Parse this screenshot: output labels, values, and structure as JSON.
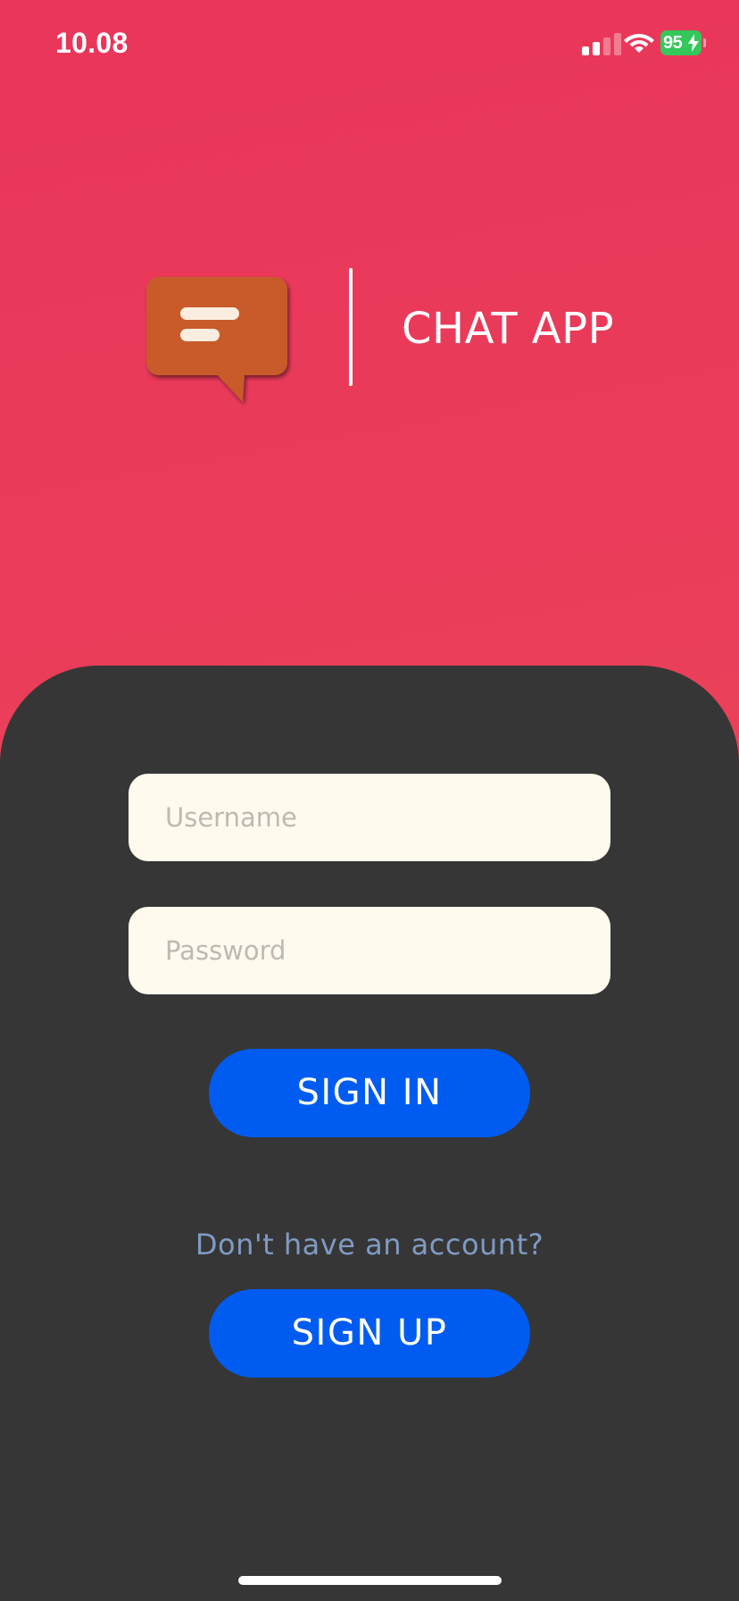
{
  "status_bar": {
    "time": "10.08",
    "battery_level": "95",
    "battery_color": "#34c759",
    "icons": [
      "cellular-signal-icon",
      "wifi-icon",
      "battery-charging-icon"
    ]
  },
  "branding": {
    "app_title": "CHAT APP",
    "logo_icon": "chat-bubble-icon",
    "logo_color": "#c95a29"
  },
  "login_form": {
    "username_placeholder": "Username",
    "username_value": "",
    "password_placeholder": "Password",
    "password_value": "",
    "sign_in_label": "SIGN IN"
  },
  "signup": {
    "prompt": "Don't have an account?",
    "sign_up_label": "SIGN UP"
  },
  "colors": {
    "header_gradient_top": "#e9355a",
    "header_gradient_bottom": "#ed5456",
    "sheet_background": "#363636",
    "button_primary": "#005cf0",
    "input_background": "#fefaed",
    "prompt_text": "#7f9bc4"
  }
}
